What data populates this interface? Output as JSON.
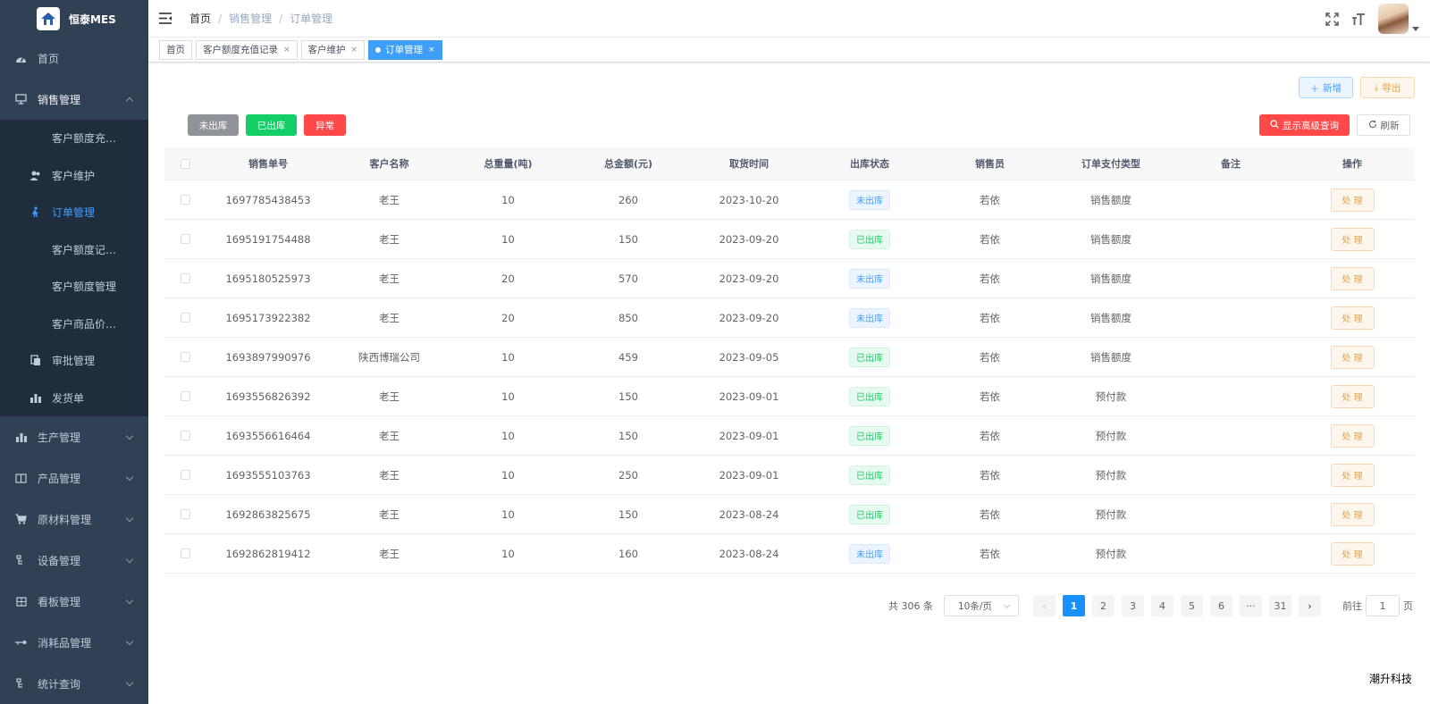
{
  "app": {
    "title": "恒泰MES"
  },
  "sidebar": {
    "home": "首页",
    "sales": {
      "label": "销售管理",
      "items": [
        {
          "label": "客户额度充…",
          "icon": ""
        },
        {
          "label": "客户维护",
          "icon": "users-icon"
        },
        {
          "label": "订单管理",
          "icon": "order-icon",
          "active": true
        },
        {
          "label": "客户额度记…",
          "icon": ""
        },
        {
          "label": "客户额度管理",
          "icon": ""
        },
        {
          "label": "客户商品价…",
          "icon": ""
        },
        {
          "label": "审批管理",
          "icon": "copy-icon"
        },
        {
          "label": "发货单",
          "icon": "chart-icon"
        }
      ]
    },
    "menus": [
      "生产管理",
      "产品管理",
      "原材料管理",
      "设备管理",
      "看板管理",
      "消耗品管理",
      "统计查询"
    ]
  },
  "breadcrumb": [
    "首页",
    "销售管理",
    "订单管理"
  ],
  "tags": {
    "home": "首页",
    "recharge": "客户额度充值记录",
    "customer": "客户维护",
    "order": "订单管理",
    "close": "×"
  },
  "toolbar": {
    "add": "新增",
    "export": "导出",
    "filter_unshipped": "未出库",
    "filter_shipped": "已出库",
    "filter_abnormal": "异常",
    "advanced_query": "显示高级查询",
    "refresh": "刷新"
  },
  "table": {
    "headers": [
      "销售单号",
      "客户名称",
      "总重量(吨)",
      "总金额(元)",
      "取货时间",
      "出库状态",
      "销售员",
      "订单支付类型",
      "备注",
      "操作"
    ],
    "rows": [
      {
        "id": "1697785438453",
        "customer": "老王",
        "weight": "10",
        "amount": "260",
        "date": "2023-10-20",
        "status": "未出库",
        "status_type": "pending",
        "seller": "若依",
        "pay": "销售额度",
        "note": "",
        "op": "处 理"
      },
      {
        "id": "1695191754488",
        "customer": "老王",
        "weight": "10",
        "amount": "150",
        "date": "2023-09-20",
        "status": "已出库",
        "status_type": "done",
        "seller": "若依",
        "pay": "销售额度",
        "note": "",
        "op": "处 理"
      },
      {
        "id": "1695180525973",
        "customer": "老王",
        "weight": "20",
        "amount": "570",
        "date": "2023-09-20",
        "status": "未出库",
        "status_type": "pending",
        "seller": "若依",
        "pay": "销售额度",
        "note": "",
        "op": "处 理"
      },
      {
        "id": "1695173922382",
        "customer": "老王",
        "weight": "20",
        "amount": "850",
        "date": "2023-09-20",
        "status": "未出库",
        "status_type": "pending",
        "seller": "若依",
        "pay": "销售额度",
        "note": "",
        "op": "处 理"
      },
      {
        "id": "1693897990976",
        "customer": "陕西博瑞公司",
        "weight": "10",
        "amount": "459",
        "date": "2023-09-05",
        "status": "已出库",
        "status_type": "done",
        "seller": "若依",
        "pay": "销售额度",
        "note": "",
        "op": "处 理"
      },
      {
        "id": "1693556826392",
        "customer": "老王",
        "weight": "10",
        "amount": "150",
        "date": "2023-09-01",
        "status": "已出库",
        "status_type": "done",
        "seller": "若依",
        "pay": "预付款",
        "note": "",
        "op": "处 理"
      },
      {
        "id": "1693556616464",
        "customer": "老王",
        "weight": "10",
        "amount": "150",
        "date": "2023-09-01",
        "status": "已出库",
        "status_type": "done",
        "seller": "若依",
        "pay": "预付款",
        "note": "",
        "op": "处 理"
      },
      {
        "id": "1693555103763",
        "customer": "老王",
        "weight": "10",
        "amount": "250",
        "date": "2023-09-01",
        "status": "已出库",
        "status_type": "done",
        "seller": "若依",
        "pay": "预付款",
        "note": "",
        "op": "处 理"
      },
      {
        "id": "1692863825675",
        "customer": "老王",
        "weight": "10",
        "amount": "150",
        "date": "2023-08-24",
        "status": "已出库",
        "status_type": "done",
        "seller": "若依",
        "pay": "预付款",
        "note": "",
        "op": "处 理"
      },
      {
        "id": "1692862819412",
        "customer": "老王",
        "weight": "10",
        "amount": "160",
        "date": "2023-08-24",
        "status": "未出库",
        "status_type": "pending",
        "seller": "若依",
        "pay": "预付款",
        "note": "",
        "op": "处 理"
      }
    ]
  },
  "pagination": {
    "total": "共 306 条",
    "page_size": "10条/页",
    "pages": [
      "1",
      "2",
      "3",
      "4",
      "5",
      "6",
      "···",
      "31"
    ],
    "current": "1",
    "goto_prefix": "前往",
    "goto_value": "1",
    "goto_suffix": "页"
  },
  "watermark": "潮升科技",
  "colors": {
    "sidebar": "#304156",
    "submenu": "#1f2d3d",
    "primary": "#1890ff",
    "success": "#13ce66",
    "danger": "#ff4949",
    "warning": "#e6a23c"
  }
}
